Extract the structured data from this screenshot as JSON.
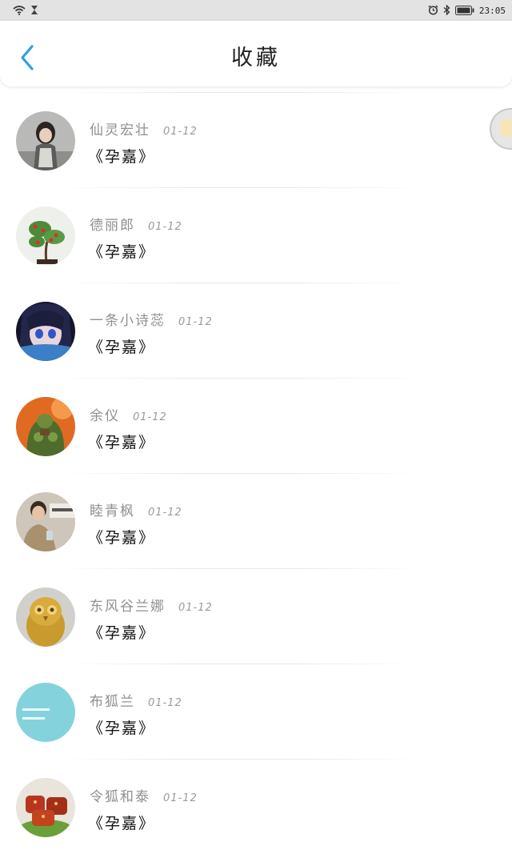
{
  "status_bar": {
    "time": "23:05",
    "left_icons": [
      "wifi-icon",
      "hourglass-icon"
    ],
    "right_icons": [
      "alarm-icon",
      "bluetooth-icon",
      "battery-icon"
    ]
  },
  "header": {
    "title": "收藏",
    "back_icon": "chevron-left-icon",
    "accent_color": "#2ea1e0"
  },
  "favorites": [
    {
      "author": "仙灵宏壮",
      "date": "01-12",
      "work": "《孕嘉》",
      "avatar": "girl-photo"
    },
    {
      "author": "德丽郎",
      "date": "01-12",
      "work": "《孕嘉》",
      "avatar": "bonsai-photo"
    },
    {
      "author": "一条小诗蕊",
      "date": "01-12",
      "work": "《孕嘉》",
      "avatar": "anime-girl"
    },
    {
      "author": "余仪",
      "date": "01-12",
      "work": "《孕嘉》",
      "avatar": "orc-warrior"
    },
    {
      "author": "睦青枫",
      "date": "01-12",
      "work": "《孕嘉》",
      "avatar": "young-man-photo"
    },
    {
      "author": "东风谷兰娜",
      "date": "01-12",
      "work": "《孕嘉》",
      "avatar": "owl-figurine"
    },
    {
      "author": "布狐兰",
      "date": "01-12",
      "work": "《孕嘉》",
      "avatar": "cyan-text-card"
    },
    {
      "author": "令狐和泰",
      "date": "01-12",
      "work": "《孕嘉》",
      "avatar": "braised-pork-photo"
    }
  ]
}
